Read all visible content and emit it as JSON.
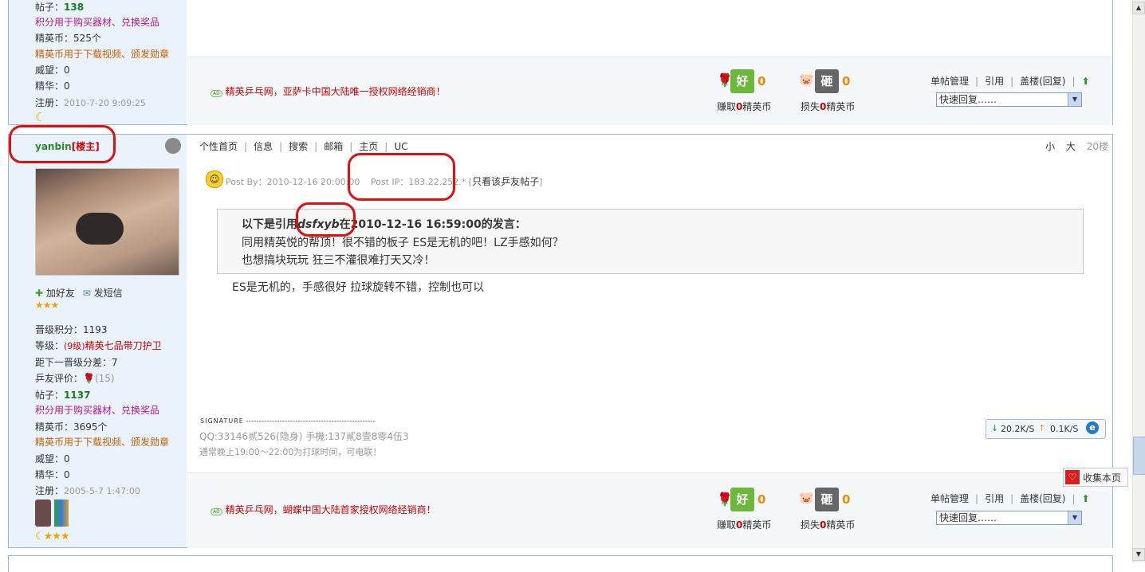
{
  "post_top": {
    "stats": {
      "posts_label": "帖子：",
      "posts_value": "138",
      "points_note": "积分用于购买器材、兑换奖品",
      "coins": "精英币：525个",
      "coins_note": "精英币用于下载视频、颁发勋章",
      "prestige": "威望：0",
      "essence": "精华：0",
      "register_label": "注册：",
      "register_date": "2010-7-20 9:09:25"
    },
    "ad_text": "精英乒乓网，亚萨卡中国大陆唯一授权网络经销商！"
  },
  "post_main": {
    "username": "yanbin",
    "role": "[楼主]",
    "nav": [
      "个性首页",
      "信息",
      "搜索",
      "邮箱",
      "主页",
      "UC"
    ],
    "font_small": "小",
    "font_large": "大",
    "floor": "20楼",
    "add_friend": "加好友",
    "send_msg": "发短信",
    "stats": {
      "level_points": "晋级积分：1193",
      "level_label": "等级：",
      "level_num": "(9级)",
      "level_name": "精英七品带刀护卫",
      "next_level": "距下一晋级分差：7",
      "rating_label": "乒友评价：",
      "rating_count": "(15)",
      "posts_label": "帖子：",
      "posts_value": "1137",
      "points_note": "积分用于购买器材、兑换奖品",
      "coins": "精英币：3695个",
      "coins_note": "精英币用于下载视频、颁发勋章",
      "prestige": "威望：0",
      "essence": "精华：0",
      "register_label": "注册：",
      "register_date": "2005-5-7 1:47:00"
    },
    "post_by": "Post By：2010-12-16 20:00:00",
    "post_ip": "Post IP：183.22.252.*",
    "only_view_prefix": "[",
    "only_view": "只看该乒友帖子",
    "only_view_suffix": "]",
    "quote_head_pre": "以下是引用",
    "quote_author": "dsfxyb",
    "quote_head_post": "在2010-12-16 16:59:00的发言：",
    "quote_line1": "同用精英悦的帮顶！很不错的板子  ES是无机的吧！LZ手感如何？",
    "quote_line2": "也想搞块玩玩  狂三不灌很难打天又冷！",
    "reply": "ES是无机的，手感很好  拉球旋转不错，控制也可以",
    "signature_label": "SIGNATURE",
    "signature_dashes": "--------------------------------------------------",
    "sig_line1": "QQ:33146贰526(隐身) 手機:137貳8壹8零4伍3",
    "sig_line2": "通常晚上19:00～22:00为打球时间，可电联！",
    "ad_text": "精英乒乓网，蝴蝶中国大陆首家授权网络经销商！"
  },
  "footer": {
    "good_icon": "好",
    "bad_icon": "砸",
    "good_count": "0",
    "bad_count": "0",
    "earn_pre": "赚取",
    "earn_num": "0",
    "earn_post": "精英币",
    "lose_pre": "损失",
    "lose_num": "0",
    "lose_post": "精英币",
    "manage": "单帖管理",
    "quote": "引用",
    "build": "盖楼(回复)",
    "quick_reply": "快速回复……"
  },
  "speed_widget": {
    "down": "20.2K/S",
    "up": "0.1K/S"
  },
  "bookmark": "收集本页",
  "colors": {
    "annotation_red": "#e01010",
    "frame_border": "#9cb7cf",
    "sidebar_bg": "#eaf3fb"
  }
}
